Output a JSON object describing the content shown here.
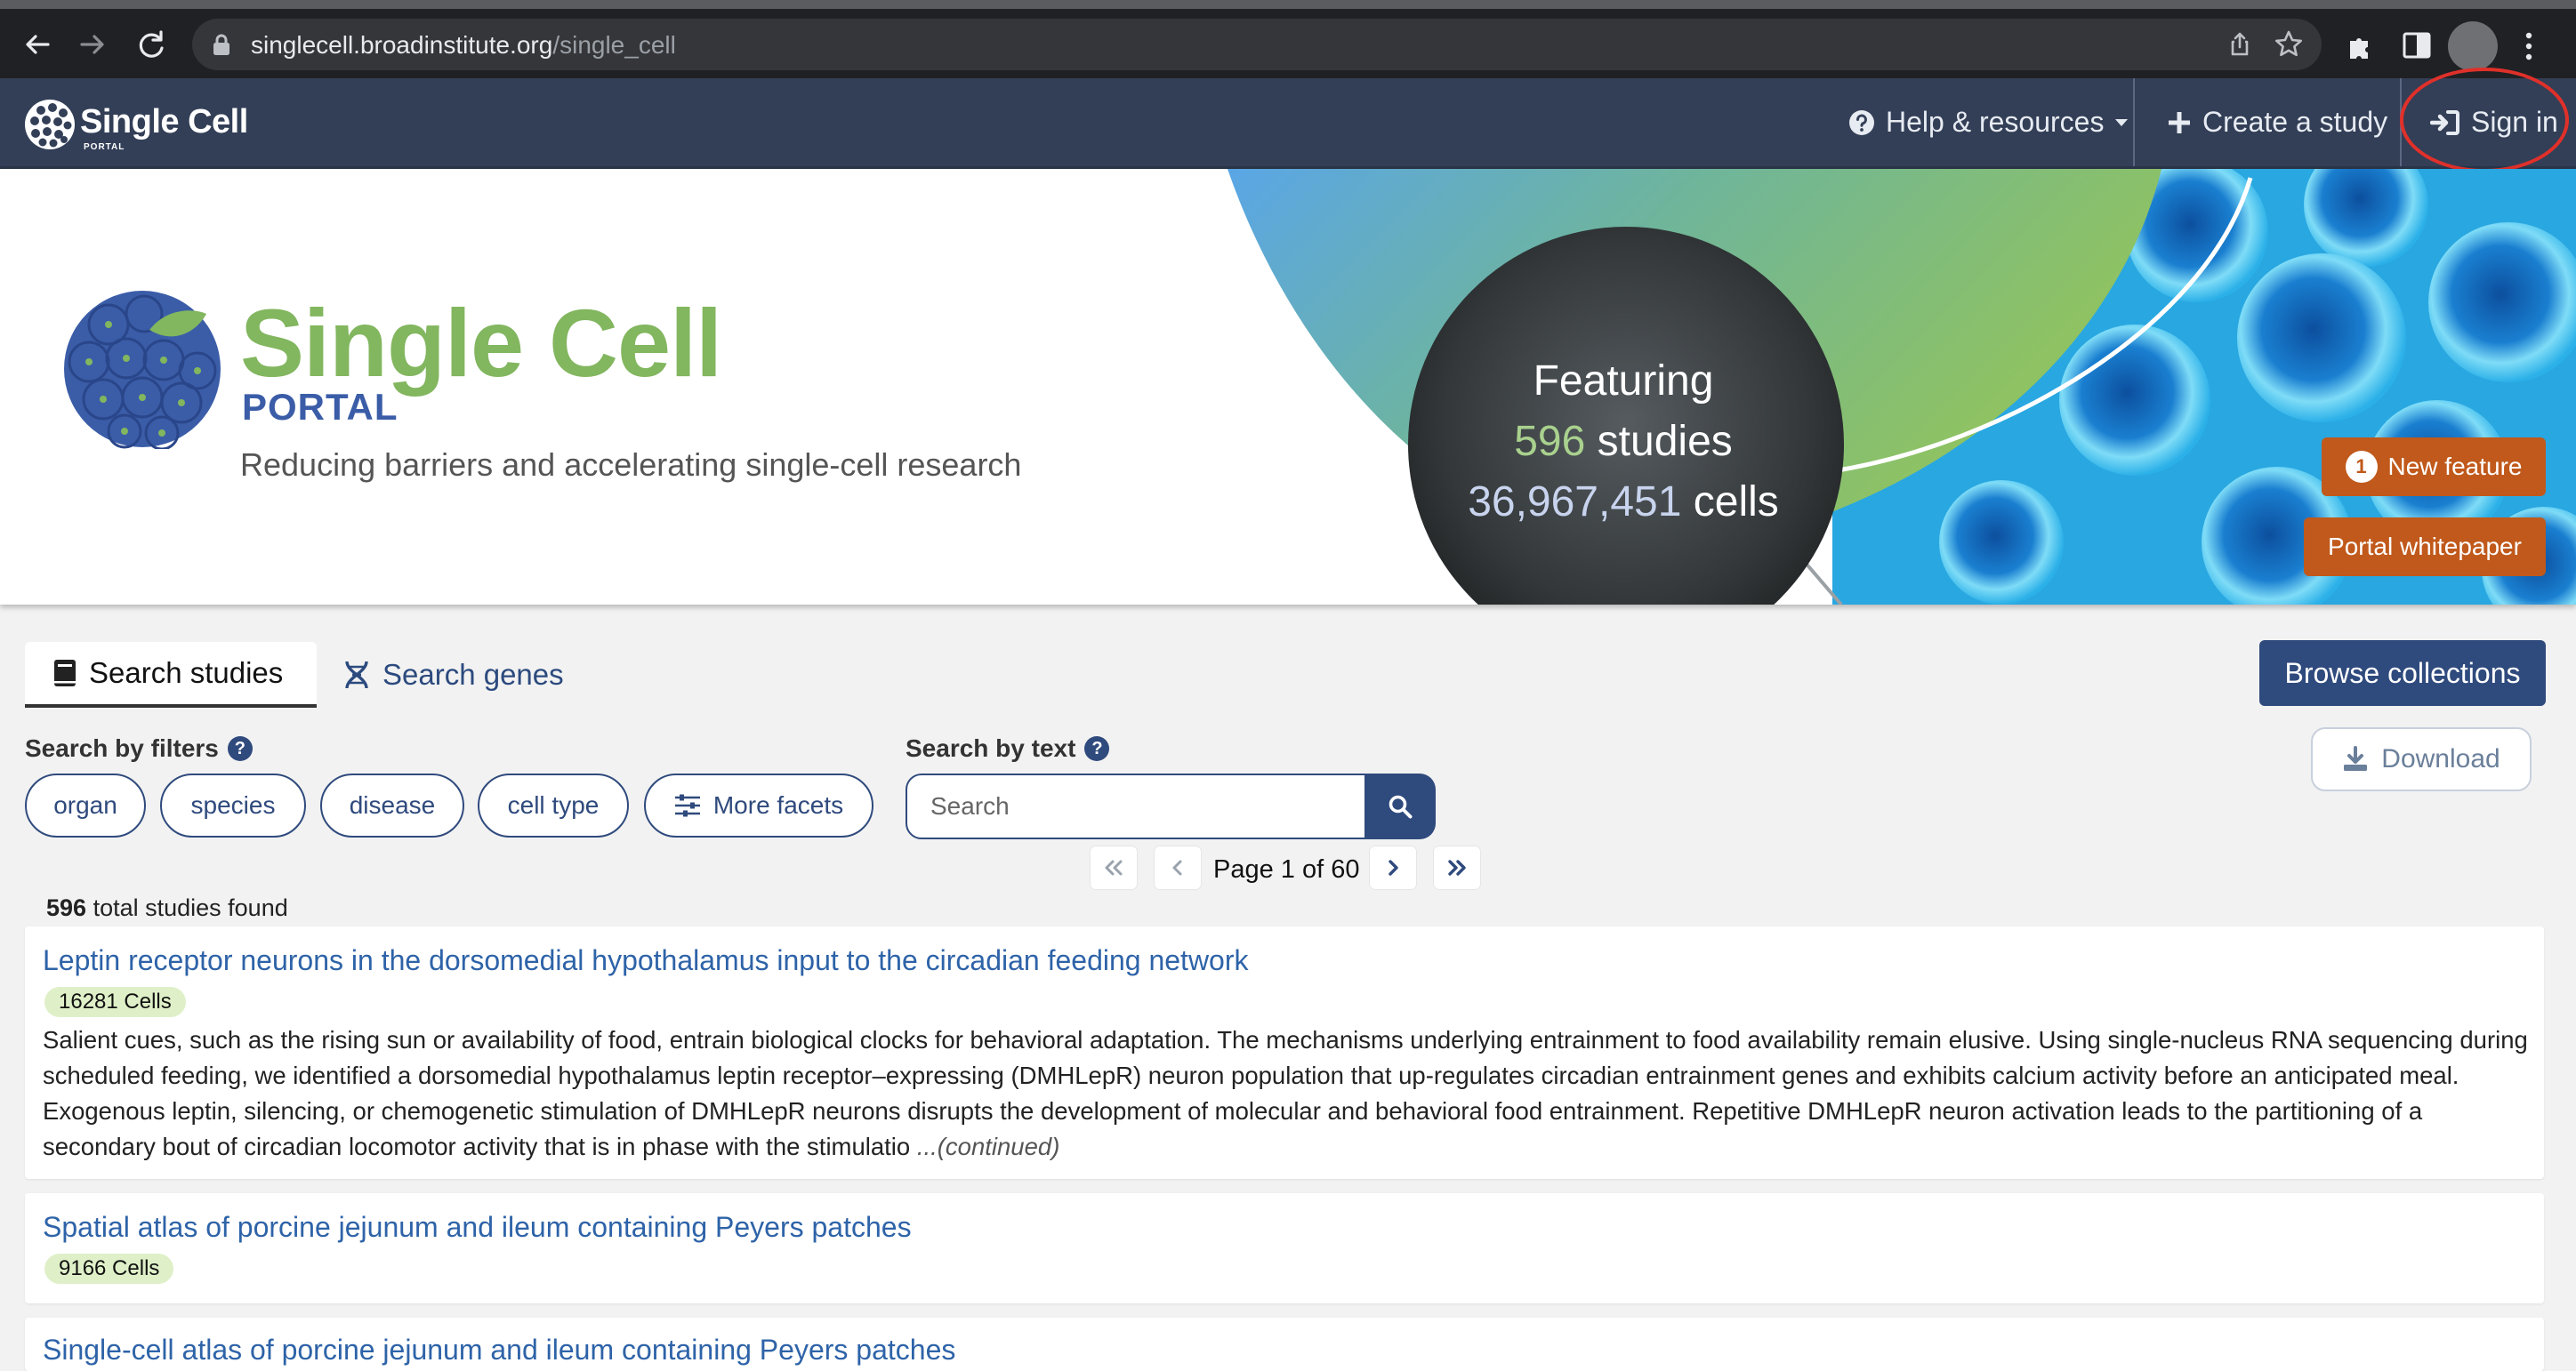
{
  "browser": {
    "url_host": "singlecell.broadinstitute.org",
    "url_path": "/single_cell"
  },
  "navbar": {
    "brand_name": "Single Cell",
    "brand_sub": "PORTAL",
    "help_label": "Help & resources",
    "create_label": "Create a study",
    "signin_label": "Sign in"
  },
  "hero": {
    "title": "Single Cell",
    "subtitle": "PORTAL",
    "tagline": "Reducing barriers and accelerating single-cell research",
    "featuring_label": "Featuring",
    "studies_count": "596",
    "studies_label": "studies",
    "cells_count": "36,967,451",
    "cells_label": "cells",
    "new_feature_count": "1",
    "new_feature_label": "New feature",
    "whitepaper_label": "Portal whitepaper"
  },
  "tabs": {
    "search_studies": "Search studies",
    "search_genes": "Search genes"
  },
  "actions": {
    "browse_collections": "Browse collections",
    "download": "Download"
  },
  "filters": {
    "label": "Search by filters",
    "facets": [
      "organ",
      "species",
      "disease",
      "cell type",
      "More facets"
    ]
  },
  "text_search": {
    "label": "Search by text",
    "placeholder": "Search"
  },
  "pagination": {
    "text": "Page 1 of 60"
  },
  "results": {
    "total_count": "596",
    "total_suffix": "total studies found",
    "studies": [
      {
        "title": "Leptin receptor neurons in the dorsomedial hypothalamus input to the circadian feeding network",
        "cells": "16281 Cells",
        "description": "Salient cues, such as the rising sun or availability of food, entrain biological clocks for behavioral adaptation. The mechanisms underlying entrainment to food availability remain elusive. Using single-nucleus RNA sequencing during scheduled feeding, we identified a dorsomedial hypothalamus leptin receptor–expressing (DMHLepR) neuron population that up-regulates circadian entrainment genes and exhibits calcium activity before an anticipated meal. Exogenous leptin, silencing, or chemogenetic stimulation of DMHLepR neurons disrupts the development of molecular and behavioral food entrainment. Repetitive DMHLepR neuron activation leads to the partitioning of a secondary bout of circadian locomotor activity that is in phase with the stimulatio",
        "continued": "...(continued)"
      },
      {
        "title": "Spatial atlas of porcine jejunum and ileum containing Peyers patches",
        "cells": "9166 Cells"
      },
      {
        "title": "Single-cell atlas of porcine jejunum and ileum containing Peyers patches"
      }
    ]
  },
  "colors": {
    "navbar_bg": "#333f57",
    "brand_green": "#82b65f",
    "primary_blue": "#2f4a7d",
    "link_blue": "#2e63a8",
    "accent_orange": "#c0591b",
    "badge_green": "#dff0c8",
    "annotation_red": "#e0302a"
  }
}
